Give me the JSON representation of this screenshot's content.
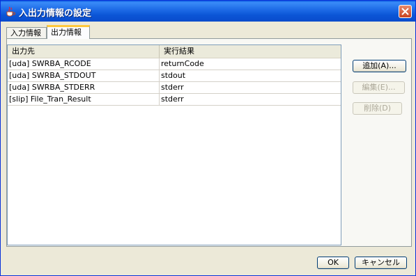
{
  "window": {
    "title": "入出力情報の設定",
    "icon": "java-cup-icon",
    "close_icon": "close-icon"
  },
  "tabs": [
    {
      "label": "入力情報",
      "selected": false
    },
    {
      "label": "出力情報",
      "selected": true
    }
  ],
  "table": {
    "columns": [
      "出力先",
      "実行結果"
    ],
    "rows": [
      [
        "[uda] SWRBA_RCODE",
        "returnCode"
      ],
      [
        "[uda] SWRBA_STDOUT",
        "stdout"
      ],
      [
        "[uda] SWRBA_STDERR",
        "stderr"
      ],
      [
        "[slip] File_Tran_Result",
        "stderr"
      ]
    ]
  },
  "buttons": {
    "add": "追加(A)...",
    "edit": "編集(E)...",
    "delete": "削除(D)",
    "ok": "OK",
    "cancel": "キャンセル"
  }
}
